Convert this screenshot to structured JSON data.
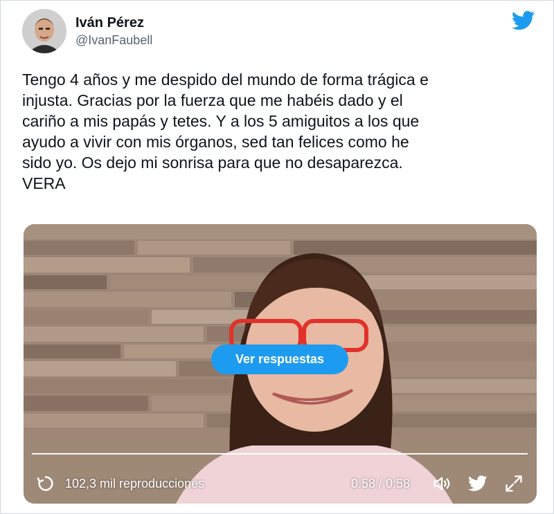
{
  "author": {
    "name": "Iván Pérez",
    "handle": "@IvanFaubell"
  },
  "tweet": {
    "text": "Tengo 4 años y me despido del mundo de forma trágica e\ninjusta. Gracias por la fuerza que me habéis dado y el\ncariño a mis papás y tetes. Y a los 5 amiguitos a los que\nayudo a vivir con mis órganos, sed tan felices como he\nsido yo. Os dejo mi sonrisa para que no desaparezca.\nVERA"
  },
  "video": {
    "replies_button": "Ver respuestas",
    "views": "102,3 mil reproducciones",
    "time": "0:58 / 0:58",
    "progress": 1.0
  },
  "icons": {
    "brand": "twitter-bird-icon",
    "replay": "replay-icon",
    "volume": "volume-icon",
    "logo": "twitter-logo-icon",
    "fullscreen": "fullscreen-icon"
  },
  "colors": {
    "accent": "#1d9bf0",
    "text": "#0f1419",
    "secondary": "#536471"
  }
}
